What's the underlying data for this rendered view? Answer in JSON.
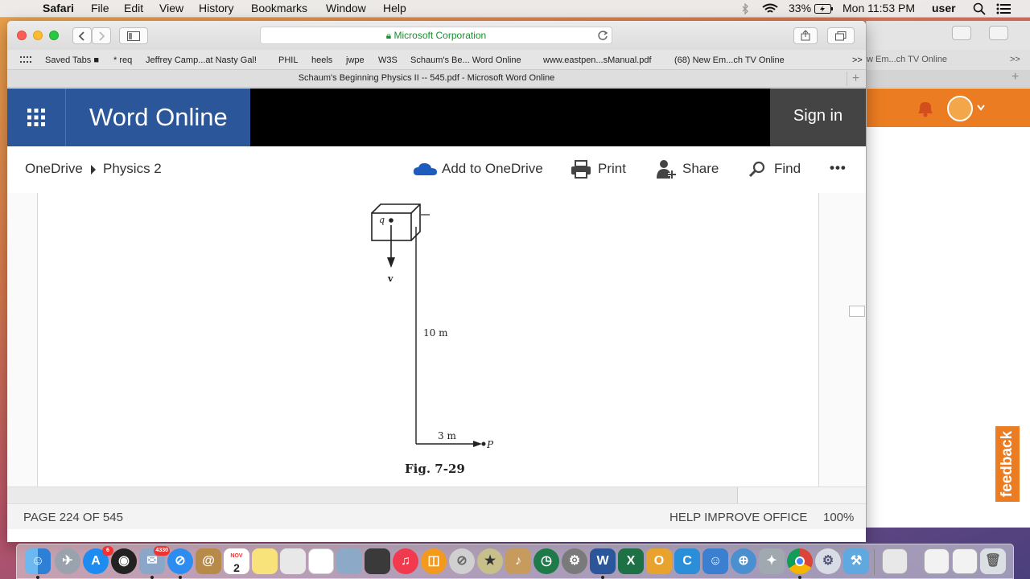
{
  "menubar": {
    "apple": "",
    "app": "Safari",
    "items": [
      "File",
      "Edit",
      "View",
      "History",
      "Bookmarks",
      "Window",
      "Help"
    ],
    "battery": "33%",
    "clock": "Mon 11:53 PM",
    "user": "user"
  },
  "safari": {
    "address": "Microsoft Corporation",
    "bookmarks_menu": "Saved Tabs",
    "bookmarks": [
      "* req",
      "Jeffrey Camp...at Nasty Gal!",
      "PHIL",
      "heels",
      "jwpe",
      "W3S",
      "Schaum's Be... Word Online",
      "www.eastpen...sManual.pdf",
      "(68) New Em...ch TV Online"
    ],
    "overflow": ">>",
    "tab_title": "Schaum's Beginning Physics II -- 545.pdf - Microsoft Word Online",
    "add_tab": "+"
  },
  "bg_window": {
    "bookmark": "w Em...ch TV Online",
    "overflow": ">>",
    "add_tab": "+",
    "feedback": "feedback"
  },
  "word": {
    "brand": "Word Online",
    "sign_in": "Sign in",
    "breadcrumb": [
      "OneDrive",
      "Physics 2"
    ],
    "commands": {
      "add": "Add to OneDrive",
      "print": "Print",
      "share": "Share",
      "find": "Find",
      "more": "•••"
    }
  },
  "figure": {
    "charge": "q",
    "velocity": "v",
    "height": "10 m",
    "distance": "3 m",
    "point": "P",
    "caption": "Fig. 7-29"
  },
  "status": {
    "page": "PAGE 224 OF 545",
    "help": "HELP IMPROVE OFFICE",
    "zoom": "100%"
  },
  "dock": {
    "appstore_badge": "6",
    "mail_badge": "4330",
    "calendar_month": "NOV",
    "calendar_day": "2"
  }
}
